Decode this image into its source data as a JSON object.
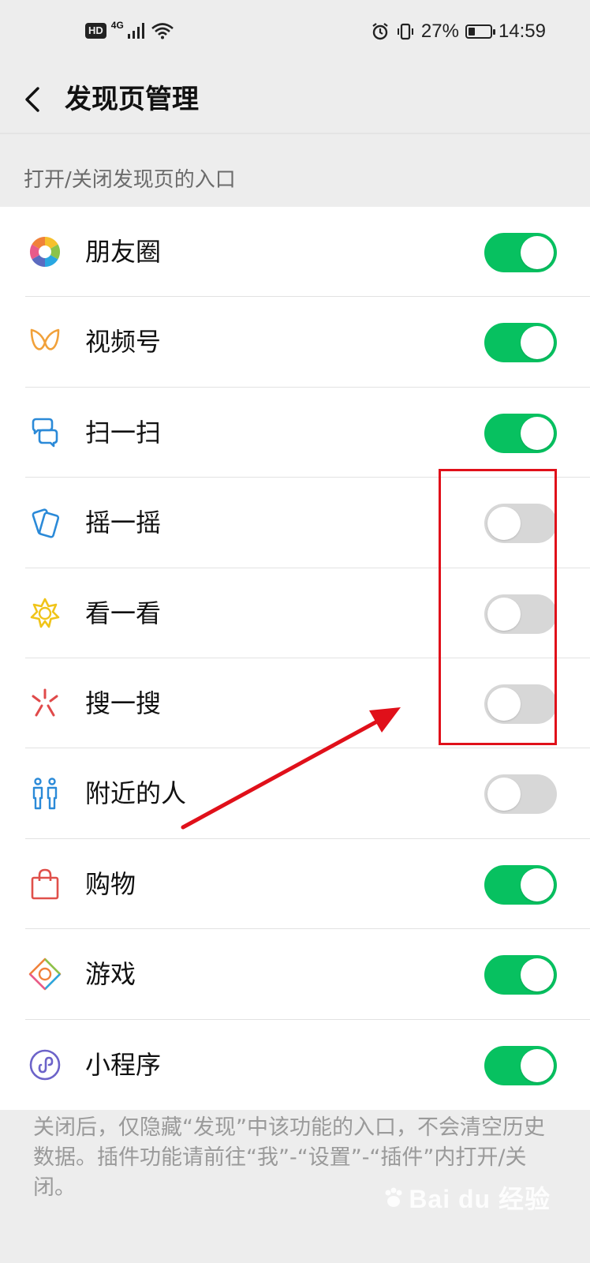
{
  "status_bar": {
    "hd": "HD",
    "network": "4G",
    "battery_percent": "27%",
    "time": "14:59"
  },
  "nav": {
    "title": "发现页管理"
  },
  "section_header": "打开/关闭发现页的入口",
  "items": [
    {
      "label": "朋友圈",
      "icon": "moments-icon",
      "enabled": true
    },
    {
      "label": "视频号",
      "icon": "channels-icon",
      "enabled": true
    },
    {
      "label": "扫一扫",
      "icon": "scan-icon",
      "enabled": true
    },
    {
      "label": "摇一摇",
      "icon": "shake-icon",
      "enabled": false
    },
    {
      "label": "看一看",
      "icon": "top-stories-icon",
      "enabled": false
    },
    {
      "label": "搜一搜",
      "icon": "search-icon",
      "enabled": false
    },
    {
      "label": "附近的人",
      "icon": "people-nearby-icon",
      "enabled": false
    },
    {
      "label": "购物",
      "icon": "shopping-icon",
      "enabled": true
    },
    {
      "label": "游戏",
      "icon": "games-icon",
      "enabled": true
    },
    {
      "label": "小程序",
      "icon": "mini-programs-icon",
      "enabled": true
    }
  ],
  "footer_note": "关闭后，仅隐藏“发现”中该功能的入口，不会清空历史数据。插件功能请前往“我”-“设置”-“插件”内打开/关闭。",
  "watermark": "Bai du 经验",
  "colors": {
    "toggle_on": "#07c160",
    "toggle_off": "#d7d7d7",
    "annotation": "#e0101a"
  }
}
